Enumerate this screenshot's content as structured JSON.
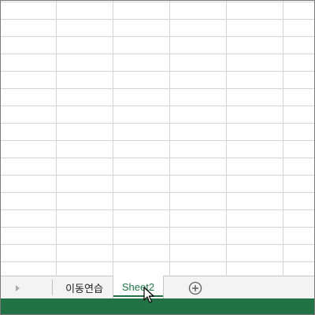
{
  "sheet_tabs": [
    {
      "label": "이동연습",
      "active": false
    },
    {
      "label": "Sheet2",
      "active": true
    }
  ],
  "icons": {
    "scroll_left": "triangle-right-icon",
    "add_sheet": "plus-circle-icon",
    "cursor": "mouse-pointer-icon"
  },
  "colors": {
    "accent": "#217346",
    "gridline": "#d4d4d4",
    "tabbar_bg": "#f3f3f3"
  }
}
